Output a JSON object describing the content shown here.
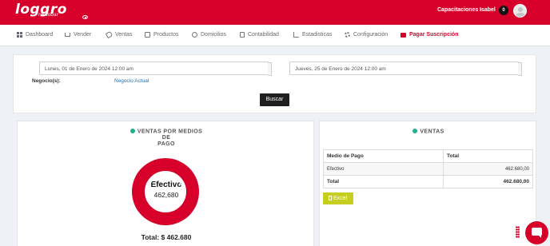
{
  "header": {
    "logo_text": "loggro",
    "logo_sub": "restobar",
    "capacitaciones": "Capacitaciones -",
    "user_name": "Isabel",
    "notif_count": "0"
  },
  "nav": [
    {
      "label": "Dashboard",
      "icon": "dashboard-icon"
    },
    {
      "label": "Vender",
      "icon": "cart-icon"
    },
    {
      "label": "Ventas",
      "icon": "tag-icon"
    },
    {
      "label": "Productos",
      "icon": "box-icon"
    },
    {
      "label": "Domicilios",
      "icon": "bike-icon"
    },
    {
      "label": "Contabilidad",
      "icon": "calculator-icon"
    },
    {
      "label": "Estadisticas",
      "icon": "chart-icon"
    },
    {
      "label": "Configuración",
      "icon": "gear-icon"
    },
    {
      "label": "Pagar Suscripción",
      "icon": "credit-card-icon"
    }
  ],
  "filters": {
    "date_from": "Lunes, 01 de Enero de 2024 12:00 am",
    "date_to": "Jueves, 25 de Enero de 2024 12:00 am",
    "negocio_label": "Negocio(s):",
    "negocio_value": "Negocio Actual",
    "search_button": "Buscar"
  },
  "payment_chart": {
    "title_line1": "VENTAS POR MEDIOS DE",
    "title_line2": "PAGO",
    "center_label": "Efectivo",
    "center_value": "462,680",
    "total": "Total: $ 462.680"
  },
  "chart_data": {
    "type": "pie",
    "categories": [
      "Efectivo"
    ],
    "values": [
      462680
    ],
    "title": "VENTAS POR MEDIOS DE PAGO"
  },
  "sales_table": {
    "title": "VENTAS",
    "columns": [
      "Medio de Pago",
      "Total"
    ],
    "rows": [
      {
        "medio": "Efectivo",
        "total": "462.680,00"
      }
    ],
    "total_label": "Total",
    "total_value": "462.680,00",
    "excel_button": "Excel"
  },
  "colors": {
    "brand": "#d6002b",
    "accent_green": "#1fb28a",
    "excel": "#c6cf21"
  }
}
